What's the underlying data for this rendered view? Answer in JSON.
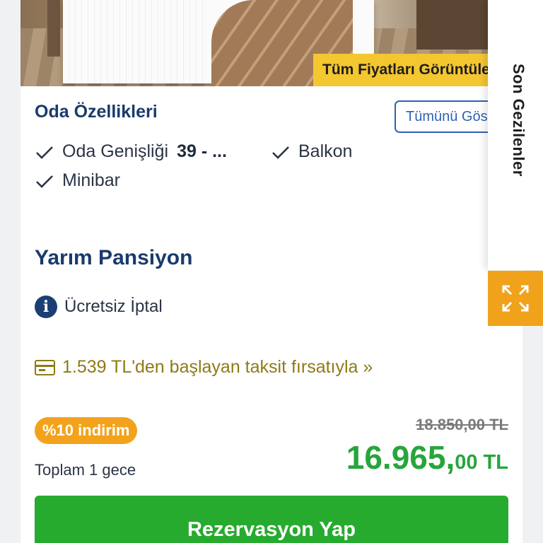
{
  "room": {
    "price_ribbon": "Tüm Fiyatları Görüntüle",
    "features_title": "Oda Özellikleri",
    "view_all_button": "Tümünü Göster",
    "features": {
      "size_label": "Oda Genişliği",
      "size_value": "39 - ...",
      "balcony": "Balkon",
      "minibar": "Minibar"
    }
  },
  "offer": {
    "board_type": "Yarım Pansiyon",
    "cancellation": "Ücretsiz İptal",
    "installment": "1.539 TL'den başlayan taksit fırsatıyla »",
    "discount_badge": "%10 indirim",
    "total_label": "Toplam 1 gece",
    "old_price": "18.850,00 TL",
    "new_price_main": "16.965,",
    "new_price_fraction": "00 TL",
    "reserve_button": "Rezervasyon Yap"
  },
  "side_panel": {
    "recent_label": "Son Gezilenler"
  },
  "colors": {
    "navy": "#193b6b",
    "accent_yellow": "#f4c630",
    "discount_orange": "#f3a21b",
    "price_green": "#27a53c",
    "button_green": "#27ab2e",
    "installment_olive": "#8e7a16"
  }
}
